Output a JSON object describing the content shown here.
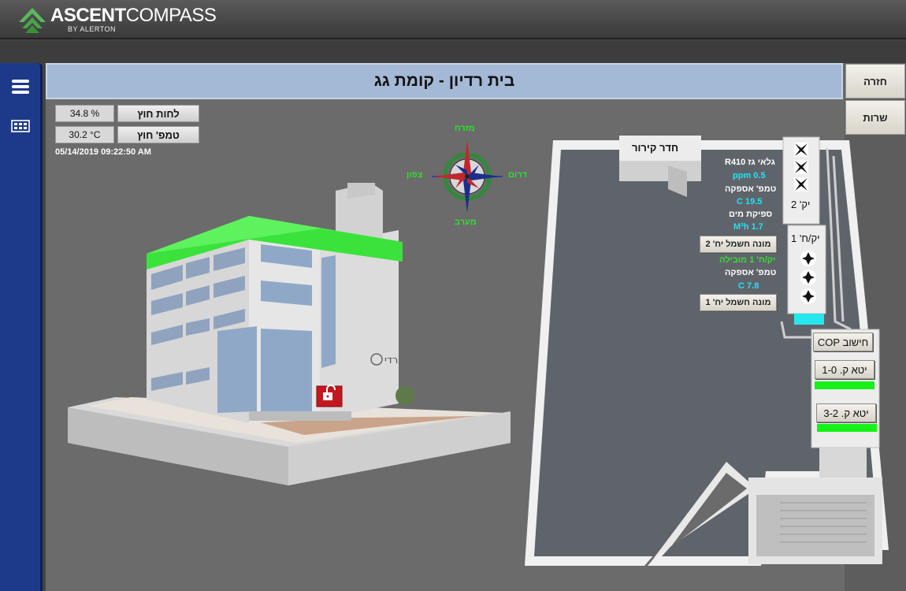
{
  "app": {
    "logo_bold": "ASCENT",
    "logo_light": "COMPASS",
    "logo_sub": "BY ALERTON"
  },
  "page": {
    "title": "בית רדיון - קומת גג"
  },
  "nav": {
    "back_label": "חזרה",
    "services_label": "שרות"
  },
  "weather": {
    "humidity_value": "34.8 %",
    "humidity_label": "לחות חוץ",
    "temp_value": "30.2 °C",
    "temp_label": "טמפ' חוץ",
    "datetime": "05/14/2019 09:22:50 AM"
  },
  "compass": {
    "north": "מזרח",
    "west": "צפון",
    "east": "דרום",
    "south": "מערב"
  },
  "building": {
    "lock_state": "unlocked"
  },
  "floorplan": {
    "cooling_room_label": "חדר קירור",
    "unit2_label": "יק' 2",
    "unit1_label": "יק/ח' 1",
    "gas_detector_label": "גלאי גז R410",
    "gas_value": "0.5 ppm",
    "supply_temp_label": "טמפ' אספקה",
    "supply_temp_value_2": "19.5 C",
    "water_flow_label": "ספיקת מים",
    "water_flow_value": "1.7 M³h",
    "meter2_button": "מונה חשמל יח' 2",
    "unit1_status": "יק/ח' 1 מובילה",
    "supply_temp_label_1": "טמפ' אספקה",
    "supply_temp_value_1": "7.8 C",
    "meter1_button": "מונה חשמל יח' 1",
    "cop_button": "חישוב COP",
    "outlet1_button": "יטא ק. 1-0",
    "outlet2_button": "יטא ק. 3-2"
  },
  "colors": {
    "sidebar": "#1d3a8a",
    "title_bar": "#a4b9d6",
    "status_green": "#19f019",
    "value_cyan": "#21e3f3",
    "label_green": "#3ed83e"
  }
}
